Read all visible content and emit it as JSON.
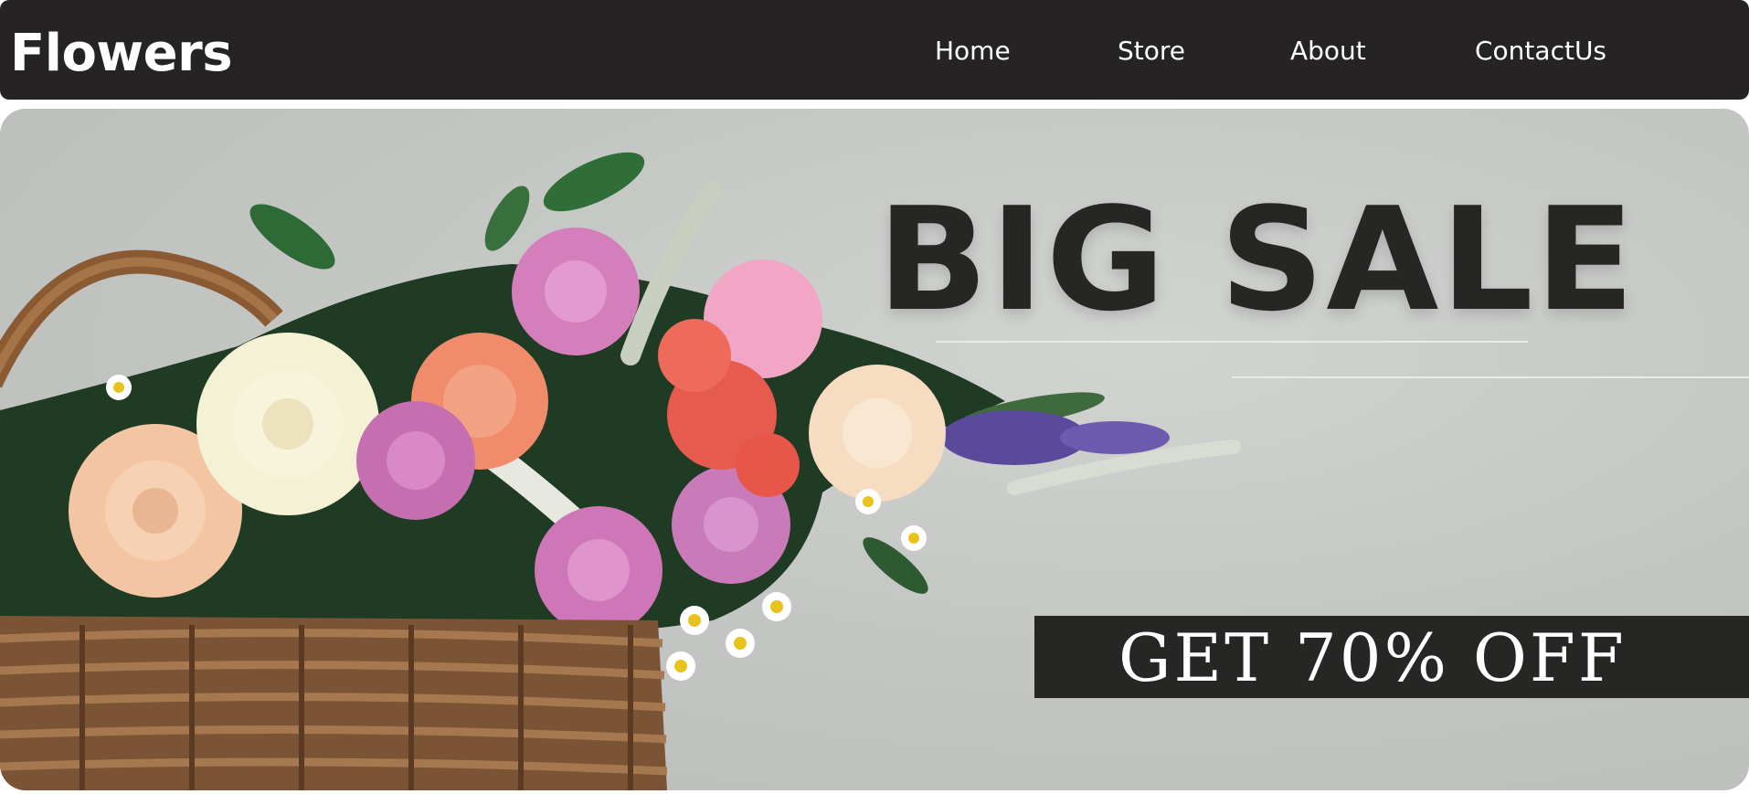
{
  "header": {
    "brand": "Flowers",
    "nav": [
      {
        "label": "Home"
      },
      {
        "label": "Store"
      },
      {
        "label": "About"
      },
      {
        "label": "ContactUs"
      }
    ]
  },
  "hero": {
    "headline": "BIG SALE",
    "offer": "GET 70% OFF",
    "image": "flower-basket-bouquet"
  },
  "colors": {
    "navbar": "#262324",
    "banner": "#262725",
    "hero_background": "#c6c8c6"
  }
}
